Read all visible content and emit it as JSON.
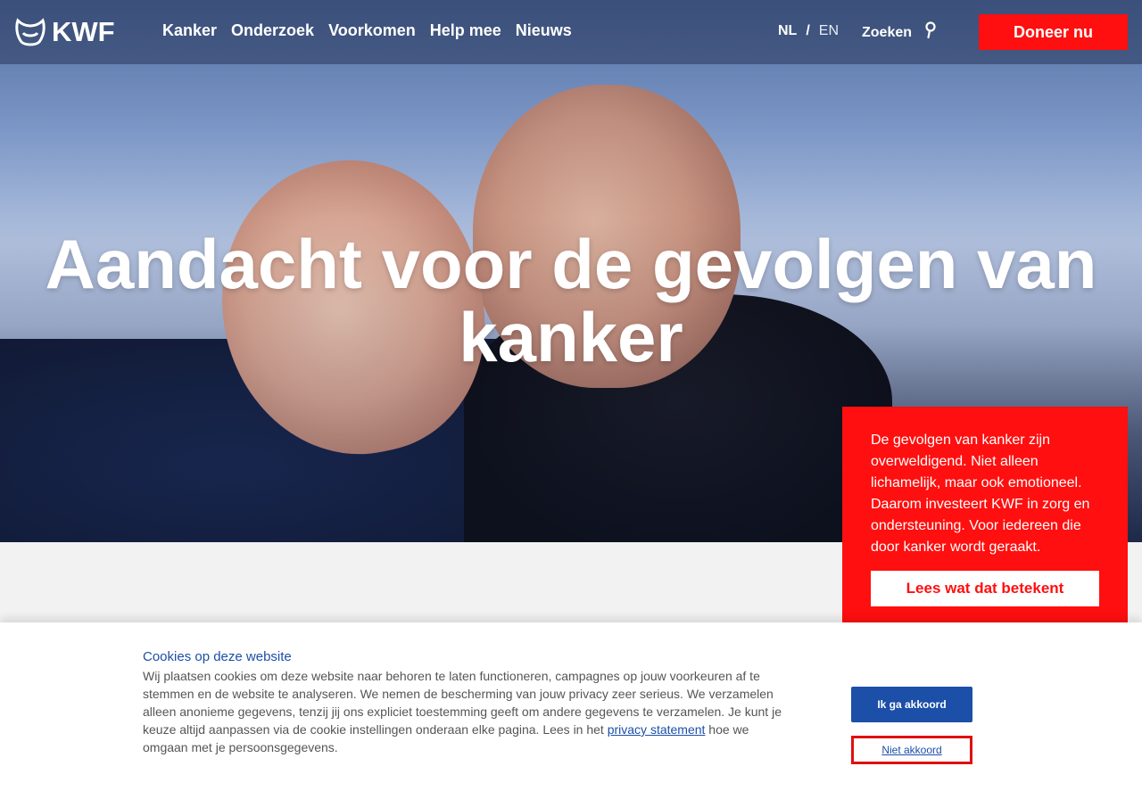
{
  "header": {
    "logo_text": "KWF",
    "nav": [
      "Kanker",
      "Onderzoek",
      "Voorkomen",
      "Help mee",
      "Nieuws"
    ],
    "lang_active": "NL",
    "lang_sep": "/",
    "lang_other": "EN",
    "search_label": "Zoeken",
    "donate_label": "Doneer nu"
  },
  "hero": {
    "title_line1": "Aandacht voor de gevolgen van",
    "title_line2": "kanker"
  },
  "card": {
    "text": "De gevolgen van kanker zijn overweldigend. Niet alleen lichamelijk, maar ook emotioneel. Daarom investeert KWF in zorg en ondersteuning. Voor iedereen die door kanker wordt geraakt.",
    "button": "Lees wat dat betekent"
  },
  "cookie": {
    "title": "Cookies op deze website",
    "text_before": "Wij plaatsen cookies om deze website naar behoren te laten functioneren, campagnes op jouw voorkeuren af te stemmen en de website te analyseren. We nemen de bescherming van jouw privacy zeer serieus. We verzamelen alleen anonieme gegevens, tenzij jij ons expliciet toestemming geeft om andere gegevens te verzamelen. Je kunt je keuze altijd aanpassen via de cookie instellingen onderaan elke pagina. Lees in het ",
    "link": "privacy statement",
    "text_after": " hoe we omgaan met je persoonsgegevens.",
    "accept": "Ik ga akkoord",
    "decline": "Niet akkoord"
  },
  "colors": {
    "brand_red": "#ff0f0f",
    "brand_blue": "#1b4fa8"
  }
}
